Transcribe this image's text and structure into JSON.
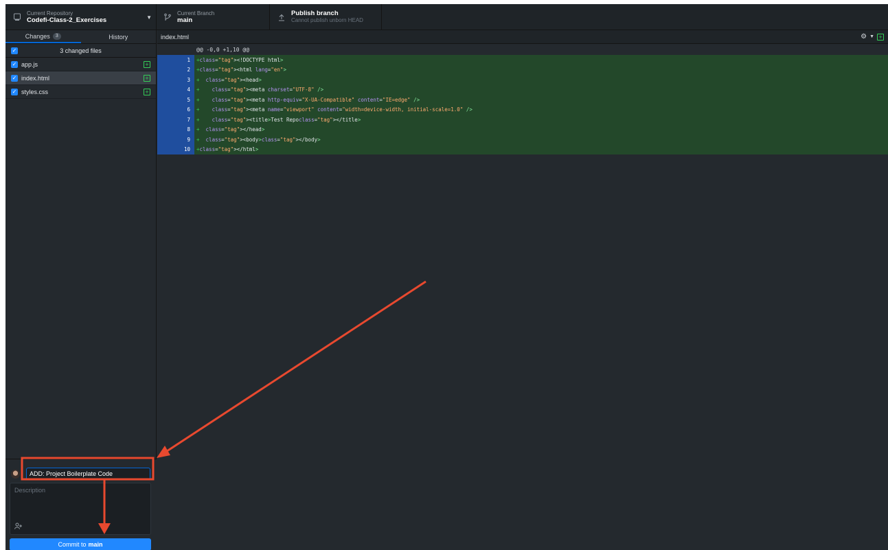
{
  "toolbar": {
    "repo_label": "Current Repository",
    "repo_name": "Codefi-Class-2_Exercises",
    "branch_label": "Current Branch",
    "branch_name": "main",
    "publish_title": "Publish branch",
    "publish_subtitle": "Cannot publish unborn HEAD"
  },
  "tabs": [
    {
      "label": "Changes",
      "count": "3",
      "active": true
    },
    {
      "label": "History",
      "active": false
    }
  ],
  "changes_header": "3 changed files",
  "files": [
    {
      "name": "app.js",
      "checked": true,
      "status": "added"
    },
    {
      "name": "index.html",
      "checked": true,
      "status": "added",
      "selected": true
    },
    {
      "name": "styles.css",
      "checked": true,
      "status": "added"
    }
  ],
  "diff": {
    "file": "index.html",
    "hunk": "@@ -0,0 +1,10 @@",
    "lines": [
      {
        "n": "1",
        "text": "+<!DOCTYPE html>"
      },
      {
        "n": "2",
        "text": "+<html lang=\"en\">"
      },
      {
        "n": "3",
        "text": "+  <head>"
      },
      {
        "n": "4",
        "text": "+    <meta charset=\"UTF-8\" />"
      },
      {
        "n": "5",
        "text": "+    <meta http-equiv=\"X-UA-Compatible\" content=\"IE=edge\" />"
      },
      {
        "n": "6",
        "text": "+    <meta name=\"viewport\" content=\"width=device-width, initial-scale=1.0\" />"
      },
      {
        "n": "7",
        "text": "+    <title>Test Repo</title>"
      },
      {
        "n": "8",
        "text": "+  </head>"
      },
      {
        "n": "9",
        "text": "+  <body></body>"
      },
      {
        "n": "10",
        "text": "+</html>"
      }
    ]
  },
  "commit": {
    "summary_value": "ADD: Project Boilerplate Code",
    "description_placeholder": "Description",
    "button_prefix": "Commit to",
    "button_branch": "main"
  },
  "colors": {
    "accent": "#2188ff",
    "annotation": "#e8492f",
    "added_bg": "#23482a",
    "gutter_bg": "#1f4e9e"
  }
}
